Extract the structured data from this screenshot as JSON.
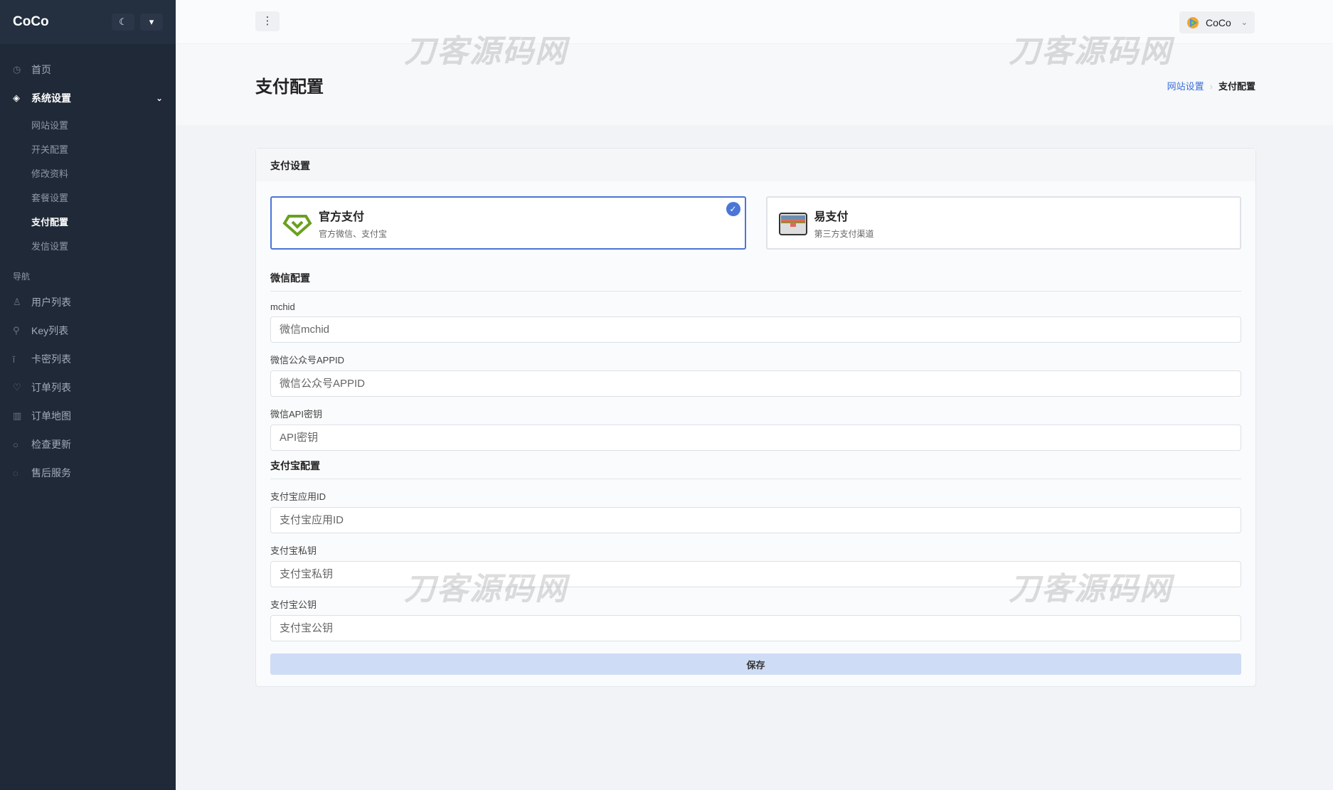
{
  "app": {
    "logo": "CoCo",
    "theme_icon": "moon-icon",
    "pin_icon": "pin-icon"
  },
  "sidebar": {
    "home": "首页",
    "system": {
      "label": "系统设置",
      "children": [
        "网站设置",
        "开关配置",
        "修改资料",
        "套餐设置",
        "支付配置",
        "发信设置"
      ],
      "active": 4
    },
    "section": "导航",
    "items": [
      {
        "label": "用户列表",
        "icon": "users-icon"
      },
      {
        "label": "Key列表",
        "icon": "key-icon"
      },
      {
        "label": "卡密列表",
        "icon": "card-icon"
      },
      {
        "label": "订单列表",
        "icon": "heart-icon"
      },
      {
        "label": "订单地图",
        "icon": "map-icon"
      },
      {
        "label": "检查更新",
        "icon": "refresh-icon"
      },
      {
        "label": "售后服务",
        "icon": "chat-icon"
      }
    ]
  },
  "topbar": {
    "user": "CoCo"
  },
  "page": {
    "title": "支付配置",
    "breadcrumb": [
      "网站设置",
      "支付配置"
    ]
  },
  "card": {
    "title": "支付设置",
    "options": [
      {
        "title": "官方支付",
        "desc": "官方微信、支付宝",
        "selected": true
      },
      {
        "title": "易支付",
        "desc": "第三方支付渠道",
        "selected": false
      }
    ],
    "wechat": {
      "title": "微信配置",
      "fields": [
        {
          "label": "mchid",
          "placeholder": "微信mchid",
          "value": ""
        },
        {
          "label": "微信公众号APPID",
          "placeholder": "微信公众号APPID",
          "value": ""
        },
        {
          "label": "微信API密钥",
          "placeholder": "API密钥",
          "value": ""
        }
      ]
    },
    "alipay": {
      "title": "支付宝配置",
      "fields": [
        {
          "label": "支付宝应用ID",
          "placeholder": "支付宝应用ID",
          "value": ""
        },
        {
          "label": "支付宝私钥",
          "placeholder": "支付宝私钥",
          "value": ""
        },
        {
          "label": "支付宝公钥",
          "placeholder": "支付宝公钥",
          "value": ""
        }
      ]
    },
    "save": "保存"
  },
  "watermark": "刀客源码网",
  "colors": {
    "sidebar": "#1f2937",
    "accent": "#4a76d6",
    "save_bg": "#cfdcf5"
  }
}
